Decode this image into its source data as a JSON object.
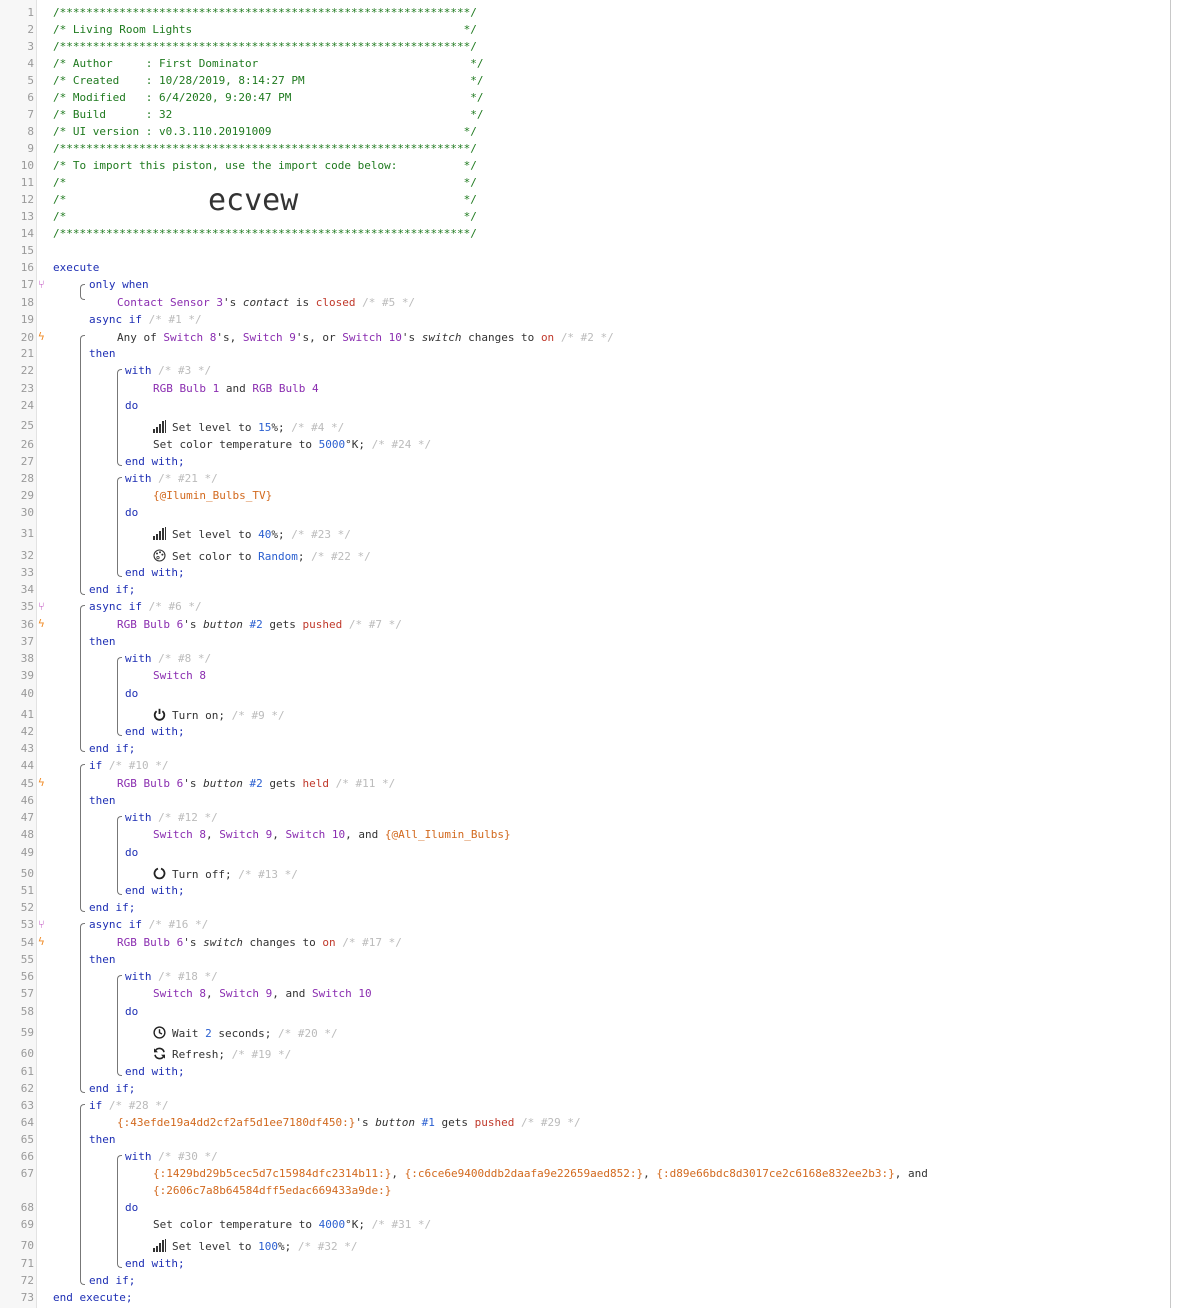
{
  "header": {
    "border": "/**************************************************************/",
    "title": "/* Living Room Lights                                         */",
    "author": "/* Author     : First Dominator                                */",
    "created": "/* Created    : 10/28/2019, 8:14:27 PM                         */",
    "modified": "/* Modified   : 6/4/2020, 9:20:47 PM                           */",
    "build": "/* Build      : 32                                             */",
    "ui_version": "/* UI version : v0.3.110.20191009                             */",
    "import_note": "/* To import this piston, use the import code below:          */",
    "blank": "/*                                                            */",
    "import_code": "ecvew"
  },
  "kw": {
    "execute": "execute",
    "end_execute": "end execute;",
    "only_when": "only when",
    "async_if": "async if",
    "if": "if",
    "then": "then",
    "with": "with",
    "do": "do",
    "end_with": "end with;",
    "end_if": "end if;",
    "and": "and",
    "any_of": "Any of",
    "or": "or"
  },
  "stmts": {
    "c5": "/* #5 */",
    "c1": "/* #1 */",
    "c2": "/* #2 */",
    "c3": "/* #3 */",
    "c4": "/* #4 */",
    "c24": "/* #24 */",
    "c21": "/* #21 */",
    "c23": "/* #23 */",
    "c22": "/* #22 */",
    "c6": "/* #6 */",
    "c7": "/* #7 */",
    "c8": "/* #8 */",
    "c9": "/* #9 */",
    "c10": "/* #10 */",
    "c11": "/* #11 */",
    "c12": "/* #12 */",
    "c13": "/* #13 */",
    "c16": "/* #16 */",
    "c17": "/* #17 */",
    "c18": "/* #18 */",
    "c20": "/* #20 */",
    "c19": "/* #19 */",
    "c28": "/* #28 */",
    "c29": "/* #29 */",
    "c30": "/* #30 */",
    "c31": "/* #31 */",
    "c32": "/* #32 */"
  },
  "devices": {
    "contact_sensor": "Contact Sensor 3",
    "switch8": "Switch 8",
    "switch9": "Switch 9",
    "switch10": "Switch 10",
    "bulb1": "RGB Bulb 1",
    "bulb4": "RGB Bulb 4",
    "bulb6": "RGB Bulb 6",
    "var_tv": "{@Ilumin_Bulbs_TV}",
    "var_all": "{@All_Ilumin_Bulbs}",
    "dev_43": "{:43efde19a4dd2cf2af5d1ee7180df450:}",
    "dev_14": "{:1429bd29b5cec5d7c15984dfc2314b11:}",
    "dev_c6": "{:c6ce6e9400ddb2daafa9e22659aed852:}",
    "dev_d8": "{:d89e66bdc8d3017ce2c6168e832ee2b3:}",
    "dev_26": "{:2606c7a8b64584dff5edac669433a9de:}"
  },
  "text": {
    "poss_s": "'s",
    "poss_s_comma": "'s,",
    "contact": "contact",
    "is": "is",
    "closed": "closed",
    "switch_attr": "switch",
    "changes_to": "changes to",
    "on": "on",
    "set_level_to": "Set level to",
    "set_color_temp_to": "Set color temperature to",
    "set_color_to": "Set color to",
    "random": "Random",
    "turn_on": "Turn on;",
    "turn_off": "Turn off;",
    "wait": "Wait",
    "seconds": "seconds;",
    "refresh": "Refresh;",
    "button": "button",
    "gets": "gets",
    "pushed": "pushed",
    "held": "held",
    "n15": "15",
    "n40": "40",
    "n100": "100",
    "n5000": "5000",
    "n4000": "4000",
    "n2": "2",
    "btn2": "#2",
    "btn1": "#1",
    "pct_semicolon": "%;",
    "kelvin_semicolon": "°K;",
    "semicolon": ";",
    "comma": ","
  },
  "line_numbers": [
    "1",
    "2",
    "3",
    "4",
    "5",
    "6",
    "7",
    "8",
    "9",
    "10",
    "11",
    "12",
    "13",
    "14",
    "15",
    "16",
    "17",
    "18",
    "19",
    "20",
    "21",
    "22",
    "23",
    "24",
    "25",
    "26",
    "27",
    "28",
    "29",
    "30",
    "31",
    "32",
    "33",
    "34",
    "35",
    "36",
    "37",
    "38",
    "39",
    "40",
    "41",
    "42",
    "43",
    "44",
    "45",
    "46",
    "47",
    "48",
    "49",
    "50",
    "51",
    "52",
    "53",
    "54",
    "55",
    "56",
    "57",
    "58",
    "59",
    "60",
    "61",
    "62",
    "63",
    "64",
    "65",
    "66",
    "67",
    "68",
    "69",
    "70",
    "71",
    "72",
    "73"
  ],
  "colors": {
    "keyword": "#1e2fb4",
    "device": "#8a2db0",
    "value": "#2a5fd0",
    "variable": "#d2691e",
    "header_comment": "#1f7a1f",
    "stmt_comment": "#bbbbbb",
    "branch_icon": "#c050c0",
    "trigger_icon": "#f08a24"
  }
}
